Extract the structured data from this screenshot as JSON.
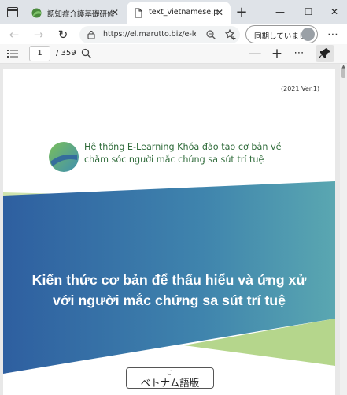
{
  "tabs": [
    {
      "label": "認知症介護基礎研修 e",
      "close": "✕"
    },
    {
      "label": "text_vietnamese.pdf",
      "close": "✕"
    }
  ],
  "new_tab_icon": "+",
  "window_controls": {
    "minimize": "—",
    "maximize": "☐",
    "close": "✕"
  },
  "toolbar": {
    "back": "←",
    "forward": "→",
    "reload": "↻",
    "url": "https://el.marutto.biz/e-le...",
    "sync_label": "同期していません",
    "more": "⋯"
  },
  "pdf_toolbar": {
    "page_number": "1",
    "page_total": "/ 359",
    "zoom_out": "—",
    "zoom_in": "+",
    "more": "⋯"
  },
  "document": {
    "version": "(2021 Ver.1)",
    "subtitle_line1": "Hệ thống E-Learning Khóa đào tạo cơ bản về",
    "subtitle_line2": "chăm sóc người mắc chứng sa sút trí tuệ",
    "title_line1": "Kiến thức cơ bản để thấu hiểu và ứng xử",
    "title_line2": "với người mắc chứng sa sút trí tuệ",
    "language_ruby": "ご",
    "language_label": "ベトナム語版"
  },
  "colors": {
    "banner_blue": "#2e63a0",
    "banner_teal": "#5aa7b1",
    "banner_green": "#b8d98a",
    "subtitle_green": "#2f6b3a"
  }
}
